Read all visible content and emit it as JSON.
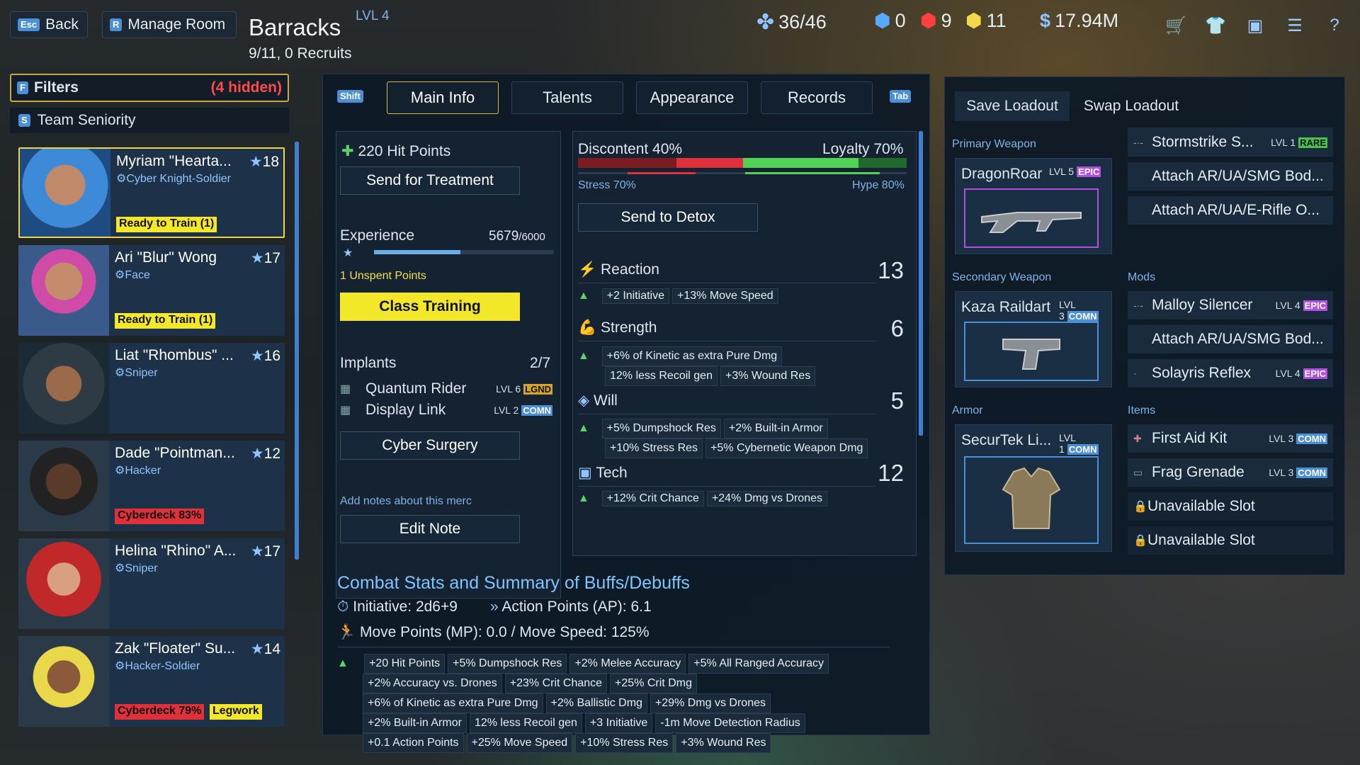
{
  "topbar": {
    "back_key": "Esc",
    "back_label": "Back",
    "manage_key": "R",
    "manage_label": "Manage Room",
    "room_title": "Barracks",
    "room_level": "LVL 4",
    "room_sub": "9/11, 0 Recruits",
    "merc_count": "36/46",
    "res_blue": "0",
    "res_red": "9",
    "res_yellow": "11",
    "money": "17.94M"
  },
  "filters": {
    "key": "F",
    "label": "Filters",
    "hidden": "(4 hidden)",
    "sort_key": "S",
    "sort_label": "Team Seniority"
  },
  "mercs": [
    {
      "name": "Myriam \"Hearta...",
      "level": "18",
      "class": "Cyber Knight-Soldier",
      "tags": [
        "Ready to Train (1)"
      ]
    },
    {
      "name": "Ari \"Blur\" Wong",
      "level": "17",
      "class": "Face",
      "tags": [
        "Ready to Train (1)"
      ]
    },
    {
      "name": "Liat \"Rhombus\" ...",
      "level": "16",
      "class": "Sniper",
      "tags": []
    },
    {
      "name": "Dade \"Pointman...",
      "level": "12",
      "class": "Hacker",
      "tags": [
        "Cyberdeck 83%"
      ]
    },
    {
      "name": "Helina \"Rhino\" A...",
      "level": "17",
      "class": "Sniper",
      "tags": []
    },
    {
      "name": "Zak \"Floater\" Su...",
      "level": "14",
      "class": "Hacker-Soldier",
      "tags": [
        "Cyberdeck 79%",
        "Legwork"
      ]
    }
  ],
  "tabs": {
    "shift_key": "Shift",
    "tab_key": "Tab",
    "items": [
      "Main Info",
      "Talents",
      "Appearance",
      "Records"
    ]
  },
  "main": {
    "hp": "220 Hit Points",
    "treatment": "Send for Treatment",
    "exp_label": "Experience",
    "exp_value": "5679",
    "exp_max": "/6000",
    "exp_fraction": 0.48,
    "unspent": "1 Unspent Points",
    "class_training": "Class Training",
    "implants_label": "Implants",
    "implants_count": "2/7",
    "implants": [
      {
        "name": "Quantum Rider",
        "lvl": "LVL 6",
        "rarity": "LGND"
      },
      {
        "name": "Display Link",
        "lvl": "LVL 2",
        "rarity": "COMN"
      }
    ],
    "cyber_surgery": "Cyber Surgery",
    "notes_label": "Add notes about this merc",
    "edit_note": "Edit Note",
    "discontent": "Discontent 40%",
    "loyalty": "Loyalty 70%",
    "stress": "Stress 70%",
    "hype": "Hype 80%",
    "detox": "Send to Detox"
  },
  "stats": [
    {
      "name": "Reaction",
      "value": "13",
      "buffs": [
        [
          "+2 Initiative",
          "+13% Move Speed"
        ]
      ]
    },
    {
      "name": "Strength",
      "value": "6",
      "buffs": [
        [
          "+6% of Kinetic as extra Pure Dmg"
        ],
        [
          "12% less Recoil gen",
          "+3% Wound Res"
        ]
      ]
    },
    {
      "name": "Will",
      "value": "5",
      "buffs": [
        [
          "+5% Dumpshock Res",
          "+2% Built-in Armor"
        ],
        [
          "+10% Stress Res",
          "+5% Cybernetic Weapon Dmg"
        ]
      ]
    },
    {
      "name": "Tech",
      "value": "12",
      "buffs": [
        [
          "+12% Crit Chance",
          "+24% Dmg vs Drones"
        ]
      ]
    }
  ],
  "combat": {
    "title": "Combat Stats and Summary of Buffs/Debuffs",
    "initiative": "Initiative: 2d6+9",
    "ap": "Action Points (AP): 6.1",
    "mp": "Move Points (MP): 0.0 / Move Speed: 125%",
    "buffs": [
      [
        "+20 Hit Points",
        "+5% Dumpshock Res",
        "+2% Melee Accuracy",
        "+5% All Ranged Accuracy"
      ],
      [
        "+2% Accuracy vs. Drones",
        "+23% Crit Chance",
        "+25% Crit Dmg"
      ],
      [
        "+6% of Kinetic as extra Pure Dmg",
        "+2% Ballistic Dmg",
        "+29% Dmg vs Drones"
      ],
      [
        "+2% Built-in Armor",
        "12% less Recoil gen",
        "+3 Initiative",
        "-1m Move Detection Radius"
      ],
      [
        "+0.1 Action Points",
        "+25% Move Speed",
        "+10% Stress Res",
        "+3% Wound Res"
      ]
    ]
  },
  "loadout": {
    "save": "Save Loadout",
    "swap": "Swap Loadout",
    "primary_label": "Primary Weapon",
    "secondary_label": "Secondary Weapon",
    "armor_label": "Armor",
    "mods_label": "Mods",
    "items_label": "Items",
    "primary": {
      "name": "DragonRoar",
      "lvl": "LVL 5",
      "rarity": "EPIC"
    },
    "secondary": {
      "name": "Kaza Raildart",
      "lvl": "LVL 3",
      "rarity": "COMN"
    },
    "armor": {
      "name": "SecurTek Li...",
      "lvl": "LVL 1",
      "rarity": "COMN"
    },
    "primary_mods": [
      {
        "name": "Stormstrike S...",
        "lvl": "LVL 1",
        "rarity": "RARE"
      },
      {
        "name": "Attach AR/UA/SMG Bod..."
      },
      {
        "name": "Attach AR/UA/E-Rifle O..."
      }
    ],
    "secondary_mods": [
      {
        "name": "Malloy Silencer",
        "lvl": "LVL 4",
        "rarity": "EPIC"
      },
      {
        "name": "Attach AR/UA/SMG Bod..."
      },
      {
        "name": "Solayris Reflex",
        "lvl": "LVL 4",
        "rarity": "EPIC"
      }
    ],
    "items": [
      {
        "name": "First Aid Kit",
        "lvl": "LVL 3",
        "rarity": "COMN"
      },
      {
        "name": "Frag Grenade",
        "lvl": "LVL 3",
        "rarity": "COMN"
      },
      {
        "name": "Unavailable Slot"
      },
      {
        "name": "Unavailable Slot"
      }
    ]
  }
}
